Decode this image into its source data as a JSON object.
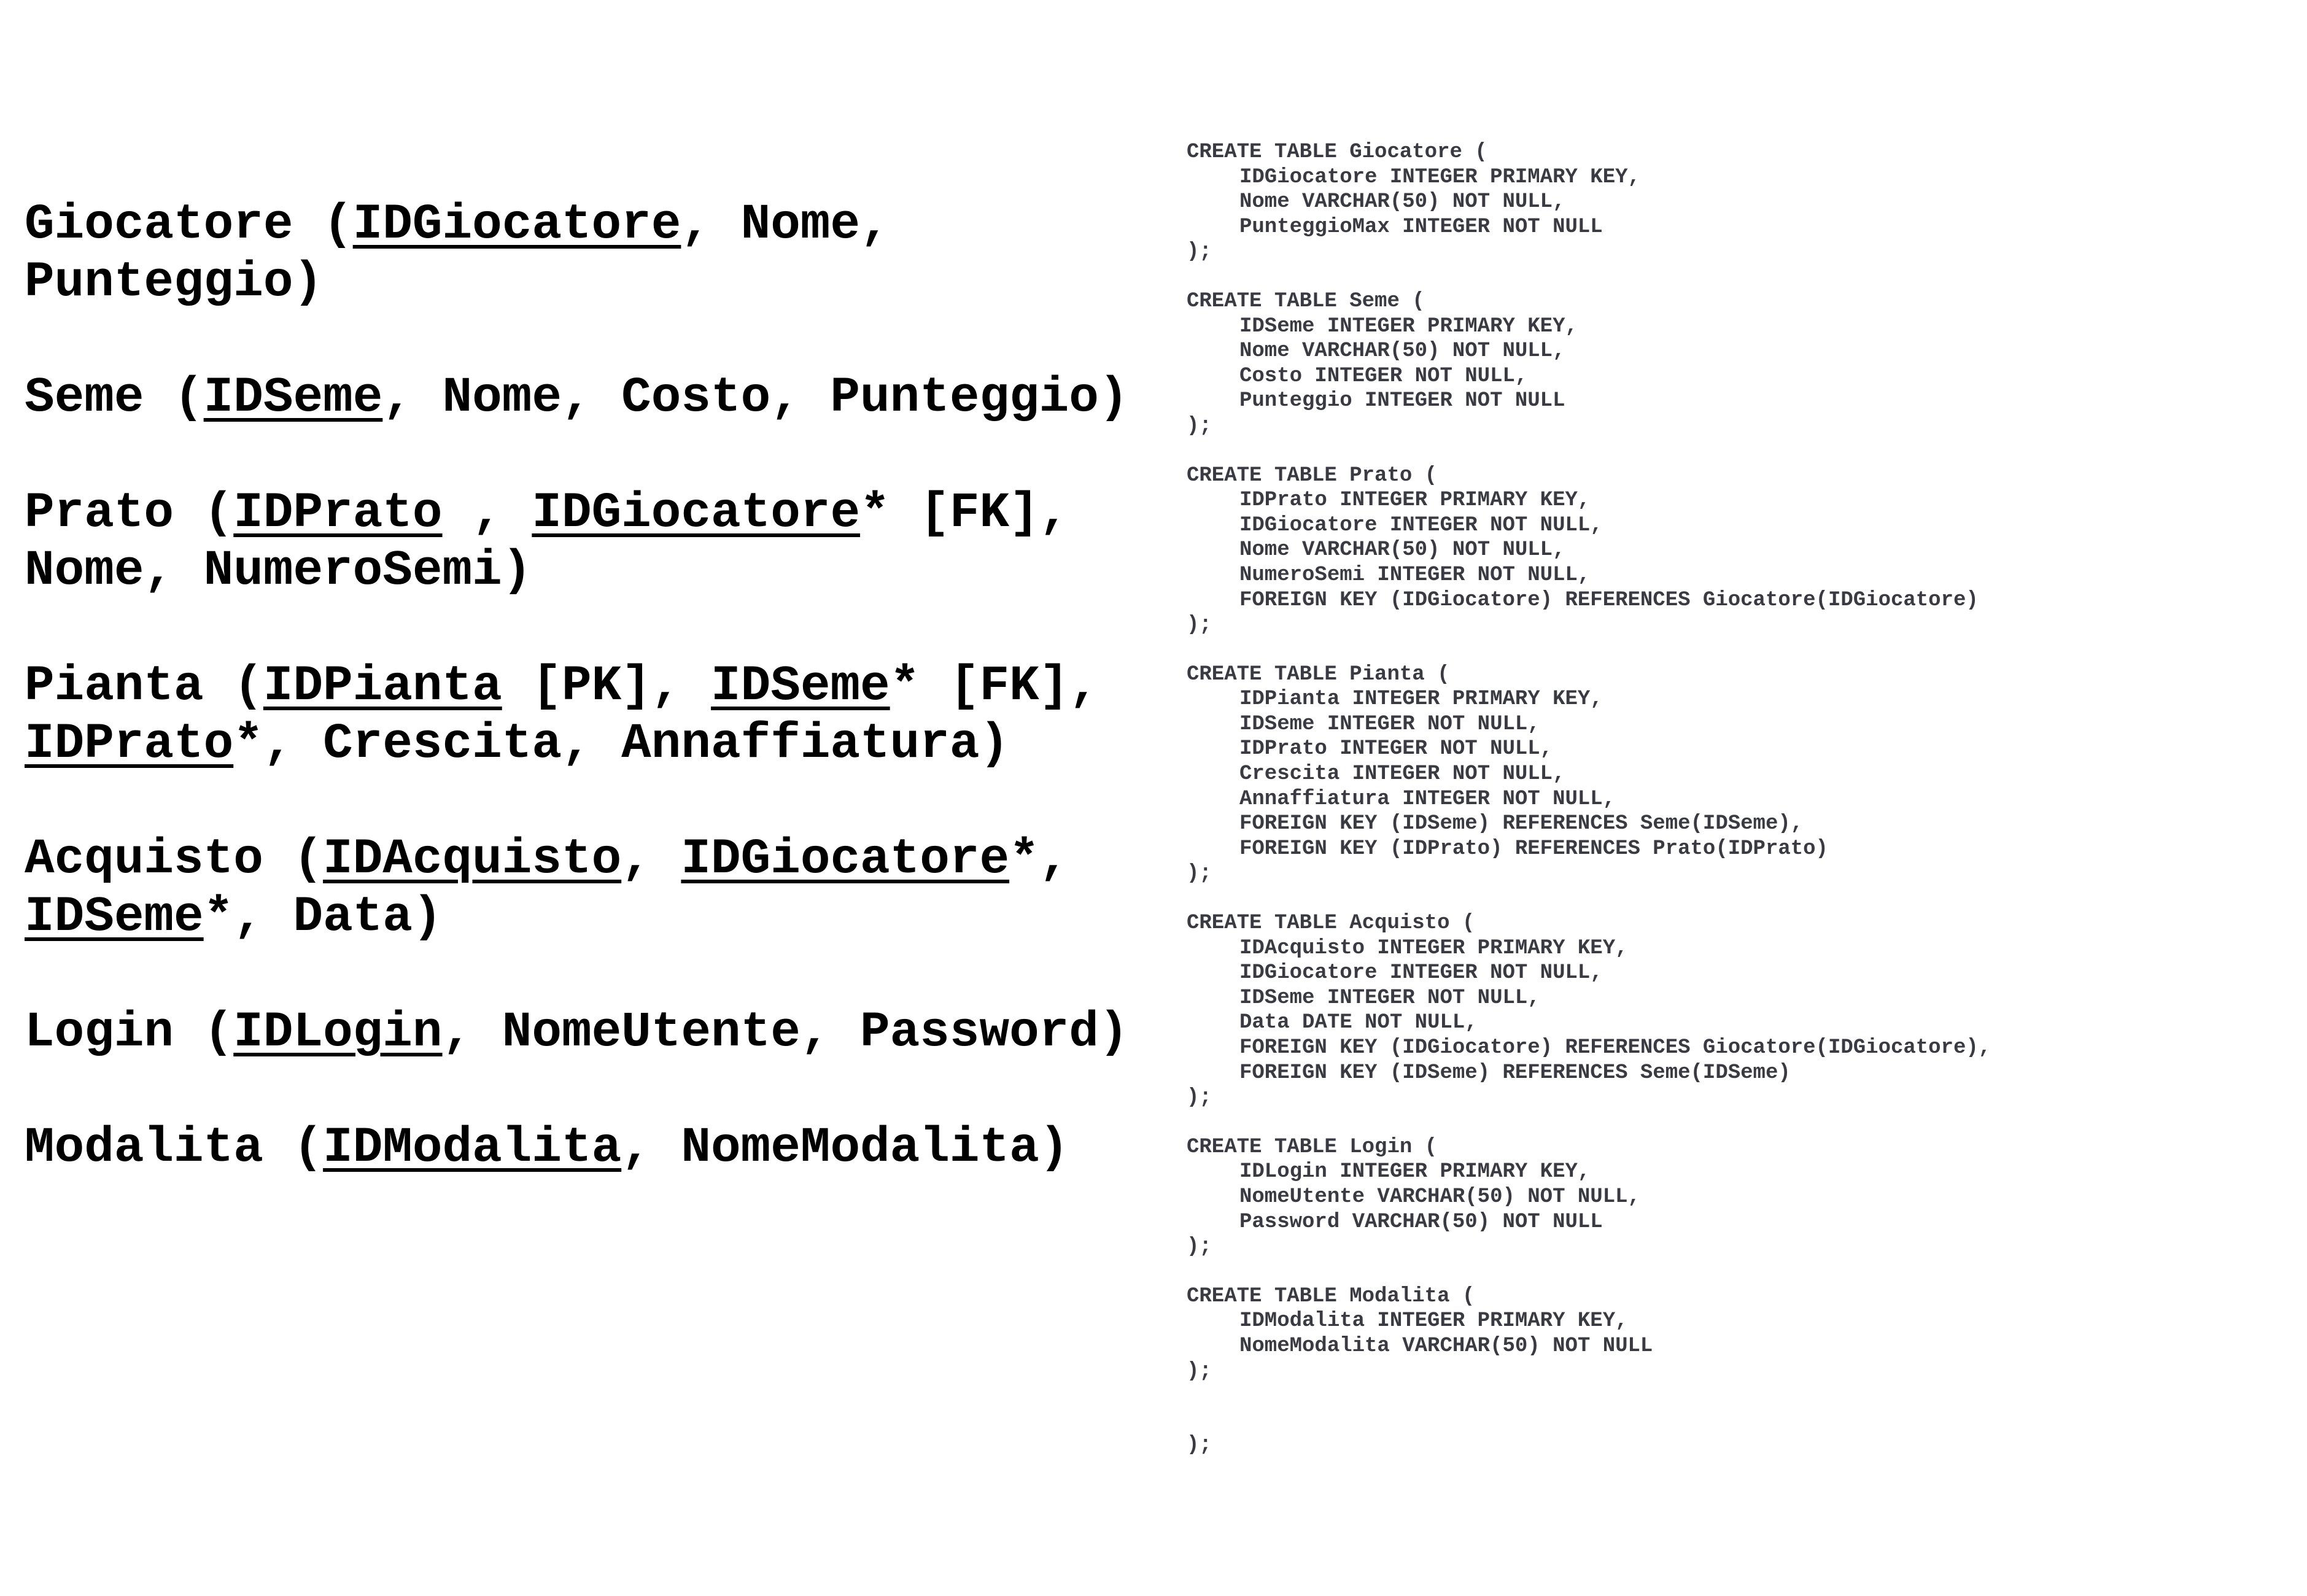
{
  "schema": [
    {
      "parts": [
        {
          "t": "Giocatore ("
        },
        {
          "t": "IDGiocatore",
          "key": true
        },
        {
          "t": ", Nome, Punteggio)"
        }
      ]
    },
    {
      "parts": [
        {
          "t": "Seme ("
        },
        {
          "t": "IDSeme",
          "key": true
        },
        {
          "t": ", Nome, Costo, Punteggio)"
        }
      ]
    },
    {
      "parts": [
        {
          "t": "Prato ("
        },
        {
          "t": "IDPrato",
          "key": true
        },
        {
          "t": " , "
        },
        {
          "t": "IDGiocatore",
          "key": true
        },
        {
          "t": "* [FK], Nome, NumeroSemi)"
        }
      ]
    },
    {
      "parts": [
        {
          "t": "Pianta ("
        },
        {
          "t": "IDPianta",
          "key": true
        },
        {
          "t": " [PK], "
        },
        {
          "t": "IDSeme",
          "key": true
        },
        {
          "t": "* [FK], "
        },
        {
          "t": "IDPrato",
          "key": true
        },
        {
          "t": "*, Crescita, Annaffiatura)"
        }
      ]
    },
    {
      "parts": [
        {
          "t": "Acquisto ("
        },
        {
          "t": "IDAcquisto",
          "key": true
        },
        {
          "t": ", "
        },
        {
          "t": "IDGiocatore",
          "key": true
        },
        {
          "t": "*, "
        },
        {
          "t": "IDSeme",
          "key": true
        },
        {
          "t": "*, Data)"
        }
      ]
    },
    {
      "parts": [
        {
          "t": "Login ("
        },
        {
          "t": "IDLogin",
          "key": true
        },
        {
          "t": ", NomeUtente, Password)"
        }
      ]
    },
    {
      "parts": [
        {
          "t": "Modalita ("
        },
        {
          "t": "IDModalita",
          "key": true
        },
        {
          "t": ", NomeModalita)"
        }
      ]
    }
  ],
  "sql": [
    {
      "header": "CREATE TABLE Giocatore (",
      "lines": [
        "IDGiocatore INTEGER PRIMARY KEY,",
        "Nome VARCHAR(50) NOT NULL,",
        "PunteggioMax INTEGER NOT NULL"
      ],
      "footer": ");"
    },
    {
      "header": "CREATE TABLE Seme (",
      "lines": [
        "IDSeme INTEGER PRIMARY KEY,",
        "Nome VARCHAR(50) NOT NULL,",
        "Costo INTEGER NOT NULL,",
        "Punteggio INTEGER NOT NULL"
      ],
      "footer": ");"
    },
    {
      "header": "CREATE TABLE Prato (",
      "lines": [
        "IDPrato INTEGER PRIMARY KEY,",
        "IDGiocatore INTEGER NOT NULL,",
        "Nome VARCHAR(50) NOT NULL,",
        "NumeroSemi INTEGER NOT NULL,",
        "FOREIGN KEY (IDGiocatore) REFERENCES Giocatore(IDGiocatore)"
      ],
      "footer": ");"
    },
    {
      "header": "CREATE TABLE Pianta (",
      "lines": [
        "IDPianta INTEGER PRIMARY KEY,",
        "IDSeme INTEGER NOT NULL,",
        "IDPrato INTEGER NOT NULL,",
        "Crescita INTEGER NOT NULL,",
        "Annaffiatura INTEGER NOT NULL,",
        "FOREIGN KEY (IDSeme) REFERENCES Seme(IDSeme),",
        "FOREIGN KEY (IDPrato) REFERENCES Prato(IDPrato)"
      ],
      "footer": ");"
    },
    {
      "header": "CREATE TABLE Acquisto (",
      "lines": [
        "IDAcquisto INTEGER PRIMARY KEY,",
        "IDGiocatore INTEGER NOT NULL,",
        "IDSeme INTEGER NOT NULL,",
        "Data DATE NOT NULL,",
        "FOREIGN KEY (IDGiocatore) REFERENCES Giocatore(IDGiocatore),",
        "FOREIGN KEY (IDSeme) REFERENCES Seme(IDSeme)"
      ],
      "footer": ");"
    },
    {
      "header": "CREATE TABLE Login (",
      "lines": [
        "IDLogin INTEGER PRIMARY KEY,",
        "NomeUtente VARCHAR(50) NOT NULL,",
        "Password VARCHAR(50) NOT NULL"
      ],
      "footer": ");"
    },
    {
      "header": "CREATE TABLE Modalita (",
      "lines": [
        "IDModalita INTEGER PRIMARY KEY,",
        "NomeModalita VARCHAR(50) NOT NULL"
      ],
      "footer": ");"
    }
  ],
  "trailing": ");"
}
